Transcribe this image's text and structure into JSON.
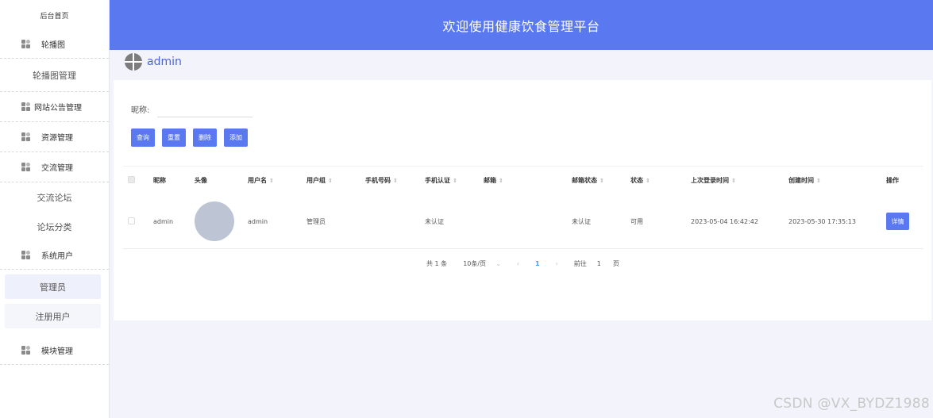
{
  "app": {
    "title": "欢迎使用健康饮食管理平台"
  },
  "user": {
    "name": "admin"
  },
  "sidebar": {
    "home": "后台首页",
    "groups": [
      {
        "label": "轮播图",
        "icon": "grid-icon",
        "children": [
          "轮播图管理"
        ]
      },
      {
        "label": "网站公告管理",
        "icon": "grid-icon",
        "children": []
      },
      {
        "label": "资源管理",
        "icon": "grid-icon",
        "children": []
      },
      {
        "label": "交流管理",
        "icon": "grid-icon",
        "children": [
          "交流论坛",
          "论坛分类"
        ]
      },
      {
        "label": "系统用户",
        "icon": "grid-icon",
        "children": [
          "管理员",
          "注册用户"
        ]
      },
      {
        "label": "模块管理",
        "icon": "grid-icon",
        "children": []
      }
    ]
  },
  "filter": {
    "nickname_label": "昵称:",
    "nickname_value": ""
  },
  "toolbar": {
    "query": "查询",
    "reset": "重置",
    "delete": "删除",
    "add": "添加"
  },
  "table": {
    "headers": [
      "昵称",
      "头像",
      "用户名",
      "用户组",
      "手机号码",
      "手机认证",
      "邮箱",
      "邮箱状态",
      "状态",
      "上次登录时间",
      "创建时间",
      "操作"
    ],
    "rows": [
      {
        "nickname": "admin",
        "username": "admin",
        "group": "管理员",
        "phone": "",
        "phone_verify": "未认证",
        "email": "",
        "email_status": "未认证",
        "status": "可用",
        "last_login": "2023-05-04 16:42:42",
        "created": "2023-05-30 17:35:13",
        "action": "详情"
      }
    ]
  },
  "pager": {
    "total": "共 1 条",
    "page_size": "10条/页",
    "current": "1",
    "goto_label": "前往",
    "goto_value": "1",
    "page_suffix": "页"
  },
  "watermark": "CSDN @VX_BYDZ1988",
  "colors": {
    "primary": "#5a78f0",
    "background": "#f3f4fb"
  }
}
